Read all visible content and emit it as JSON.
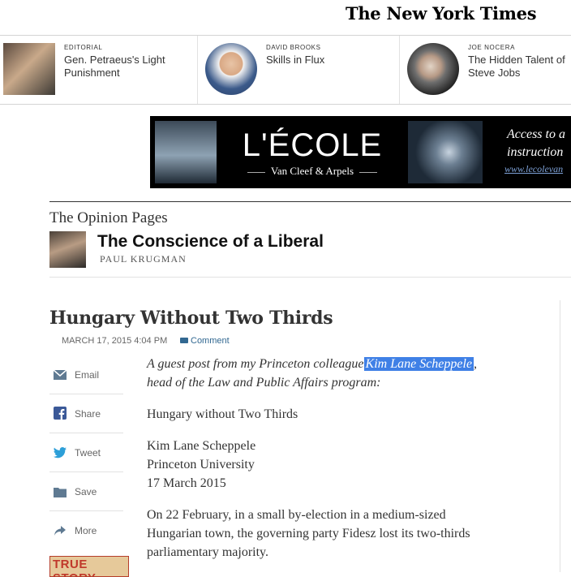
{
  "masthead": {
    "logo": "The New York Times"
  },
  "ribbon": [
    {
      "kicker": "EDITORIAL",
      "title": "Gen. Petraeus's Light Punishment"
    },
    {
      "kicker": "DAVID BROOKS",
      "title": "Skills in Flux"
    },
    {
      "kicker": "JOE NOCERA",
      "title": "The Hidden Talent of Steve Jobs"
    }
  ],
  "ad": {
    "brand": "L'ÉCOLE",
    "sub": "Van Cleef & Arpels",
    "cta_line1": "Access to a",
    "cta_line2": "instruction",
    "url": "www.lecolevan"
  },
  "section": {
    "name": "The Opinion Pages",
    "blog_title": "The Conscience of a Liberal",
    "blog_author": "PAUL KRUGMAN"
  },
  "article": {
    "headline": "Hungary Without Two Thirds",
    "dateline": "MARCH 17, 2015 4:04 PM",
    "comment_label": "Comment",
    "intro_before": "A guest post from my Princeton colleague",
    "intro_highlight": "Kim Lane Scheppele",
    "intro_after": ",",
    "intro_line2": "head of the Law and Public Affairs program:",
    "subtitle": "Hungary without Two Thirds",
    "author_name": "Kim Lane Scheppele",
    "author_affil": "Princeton University",
    "author_date": "17 March 2015",
    "para1_line1": "On 22 February, in a small by-election in a medium-sized",
    "para1_line2": "Hungarian town, the governing party Fidesz lost its two-thirds",
    "para1_line3": "parliamentary majority."
  },
  "share_tools": [
    {
      "label": "Email",
      "icon": "envelope-icon"
    },
    {
      "label": "Share",
      "icon": "facebook-icon"
    },
    {
      "label": "Tweet",
      "icon": "twitter-icon"
    },
    {
      "label": "Save",
      "icon": "folder-icon"
    },
    {
      "label": "More",
      "icon": "share-arrow-icon"
    }
  ],
  "book_promo": {
    "label": "TRUE STORY"
  },
  "colors": {
    "link": "#326891",
    "selection": "#3f80e6",
    "rule": "#e2e2e2"
  }
}
